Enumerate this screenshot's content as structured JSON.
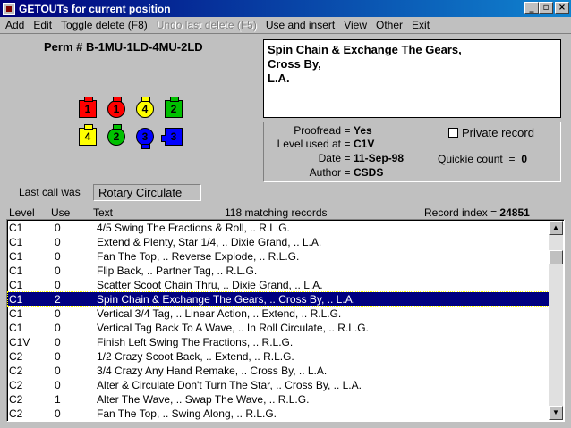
{
  "window": {
    "title": "GETOUTs for current position",
    "buttons": {
      "minimize": "_",
      "maximize": "▫",
      "close": "×"
    }
  },
  "menu": [
    {
      "label": "Add",
      "enabled": true
    },
    {
      "label": "Edit",
      "enabled": true
    },
    {
      "label": "Toggle delete (F8)",
      "enabled": true
    },
    {
      "label": "Undo last delete (F5)",
      "enabled": false
    },
    {
      "label": "Use and insert",
      "enabled": true
    },
    {
      "label": "View",
      "enabled": true
    },
    {
      "label": "Other",
      "enabled": true
    },
    {
      "label": "Exit",
      "enabled": true
    }
  ],
  "perm": "Perm # B-1MU-1LD-4MU-2LD",
  "dancers": [
    {
      "number": "1",
      "color": "#ff0000",
      "shape": "square",
      "facing": "up"
    },
    {
      "number": "1",
      "color": "#ff0000",
      "shape": "round",
      "facing": "up"
    },
    {
      "number": "4",
      "color": "#ffff00",
      "shape": "round",
      "facing": "up"
    },
    {
      "number": "2",
      "color": "#00c000",
      "shape": "square",
      "facing": "up"
    },
    {
      "number": "4",
      "color": "#ffff00",
      "shape": "square",
      "facing": "up"
    },
    {
      "number": "2",
      "color": "#00c000",
      "shape": "round",
      "facing": "up"
    },
    {
      "number": "3",
      "color": "#0000ff",
      "shape": "round",
      "facing": "down"
    },
    {
      "number": "3",
      "color": "#0000ff",
      "shape": "square",
      "facing": "left"
    }
  ],
  "call_text": [
    "Spin Chain & Exchange The Gears,",
    "Cross By,",
    "L.A."
  ],
  "info": {
    "proofread_label": "Proofread",
    "proofread_value": "Yes",
    "level_label": "Level used at",
    "level_value": "C1V",
    "date_label": "Date",
    "date_value": "11-Sep-98",
    "author_label": "Author",
    "author_value": "CSDS",
    "eq": "=",
    "private_label": "Private record",
    "private_checked": false,
    "quickie_label": "Quickie count",
    "quickie_value": "0"
  },
  "last_call_label": "Last call was",
  "last_call_value": "Rotary Circulate",
  "columns": {
    "level": "Level",
    "use": "Use",
    "text": "Text"
  },
  "matching": "118 matching records",
  "record_index_label": "Record index",
  "record_index_value": "24851",
  "rows": [
    {
      "level": "C1",
      "use": "0",
      "text": "4/5 Swing The Fractions & Roll, .. R.L.G."
    },
    {
      "level": "C1",
      "use": "0",
      "text": "Extend & Plenty, Star 1/4, .. Dixie Grand, .. L.A."
    },
    {
      "level": "C1",
      "use": "0",
      "text": "Fan The Top, .. Reverse Explode, .. R.L.G."
    },
    {
      "level": "C1",
      "use": "0",
      "text": "Flip Back, .. Partner Tag, .. R.L.G."
    },
    {
      "level": "C1",
      "use": "0",
      "text": "Scatter Scoot Chain Thru, .. Dixie Grand, .. L.A."
    },
    {
      "level": "C1",
      "use": "2",
      "text": "Spin Chain & Exchange The Gears, .. Cross By, .. L.A.",
      "selected": true
    },
    {
      "level": "C1",
      "use": "0",
      "text": "Vertical 3/4 Tag, .. Linear Action, .. Extend, .. R.L.G."
    },
    {
      "level": "C1",
      "use": "0",
      "text": "Vertical Tag Back To A Wave, .. In Roll Circulate, .. R.L.G."
    },
    {
      "level": "C1V",
      "use": "0",
      "text": "Finish Left Swing The Fractions, .. R.L.G."
    },
    {
      "level": "C2",
      "use": "0",
      "text": "1/2 Crazy Scoot Back, .. Extend, .. R.L.G."
    },
    {
      "level": "C2",
      "use": "0",
      "text": "3/4 Crazy Any Hand Remake, .. Cross By, .. L.A."
    },
    {
      "level": "C2",
      "use": "0",
      "text": "Alter & Circulate Don't Turn The Star, .. Cross By, .. L.A."
    },
    {
      "level": "C2",
      "use": "1",
      "text": "Alter The Wave, .. Swap The Wave, .. R.L.G."
    },
    {
      "level": "C2",
      "use": "0",
      "text": "Fan The Top, .. Swing Along, .. R.L.G."
    }
  ]
}
